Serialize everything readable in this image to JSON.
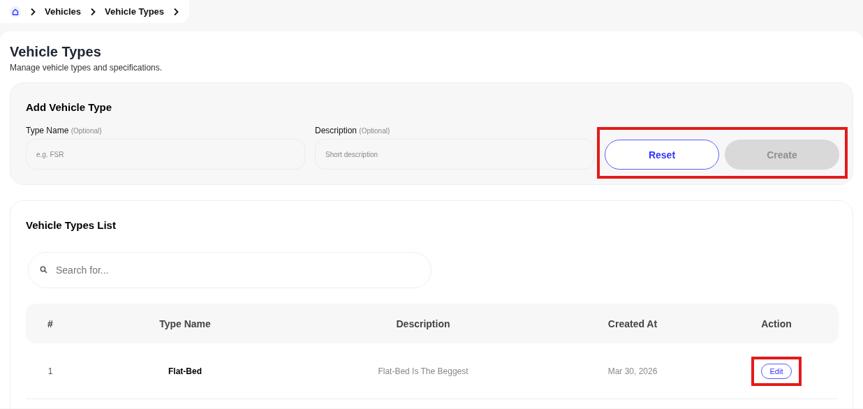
{
  "breadcrumb": {
    "items": [
      "Vehicles",
      "Vehicle Types"
    ]
  },
  "page": {
    "title": "Vehicle Types",
    "subtitle": "Manage vehicle types and specifications."
  },
  "add_form": {
    "title": "Add Vehicle Type",
    "fields": [
      {
        "label": "Type Name",
        "hint": "(Optional)",
        "placeholder": "e.g. FSR"
      },
      {
        "label": "Description",
        "hint": "(Optional)",
        "placeholder": "Short description"
      }
    ],
    "buttons": [
      {
        "label": "Reset",
        "kind": "outline",
        "disabled": false
      },
      {
        "label": "Create",
        "kind": "filled",
        "disabled": true
      }
    ],
    "buttons_highlighted": true
  },
  "list": {
    "title": "Vehicle Types List",
    "search": {
      "placeholder": "Search for..."
    },
    "table": {
      "columns": [
        "#",
        "Type Name",
        "Description",
        "Created At",
        "Action"
      ],
      "rows": [
        {
          "number": "1",
          "type_name": "Flat-Bed",
          "description": "Flat-Bed Is The Beggest",
          "created_at": "Mar 30, 2026",
          "action": "Edit",
          "action_highlighted": true
        }
      ]
    }
  }
}
